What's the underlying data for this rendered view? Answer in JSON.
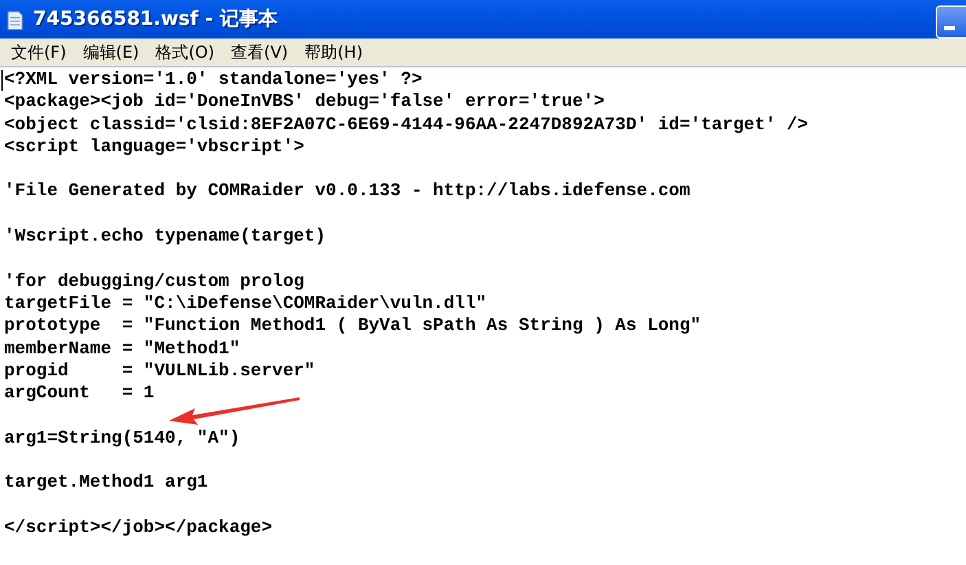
{
  "window": {
    "title": "745366581.wsf - 记事本"
  },
  "menu": [
    "文件(F)",
    "编辑(E)",
    "格式(O)",
    "查看(V)",
    "帮助(H)"
  ],
  "editor": {
    "blocks": [
      [
        "<?XML version='1.0' standalone='yes' ?>",
        "<package><job id='DoneInVBS' debug='false' error='true'>",
        "<object classid='clsid:8EF2A07C-6E69-4144-96AA-2247D892A73D' id='target' />",
        "<script language='vbscript'>"
      ],
      [
        "'File Generated by COMRaider v0.0.133 - http://labs.idefense.com"
      ],
      [
        "'Wscript.echo typename(target)"
      ],
      [
        "'for debugging/custom prolog",
        "targetFile = \"C:\\iDefense\\COMRaider\\vuln.dll\"",
        "prototype  = \"Function Method1 ( ByVal sPath As String ) As Long\"",
        "memberName = \"Method1\"",
        "progid     = \"VULNLib.server\"",
        "argCount   = 1"
      ],
      [
        "arg1=String(5140, \"A\")"
      ],
      [
        "target.Method1 arg1"
      ],
      [
        "</script></job></package>"
      ]
    ]
  }
}
